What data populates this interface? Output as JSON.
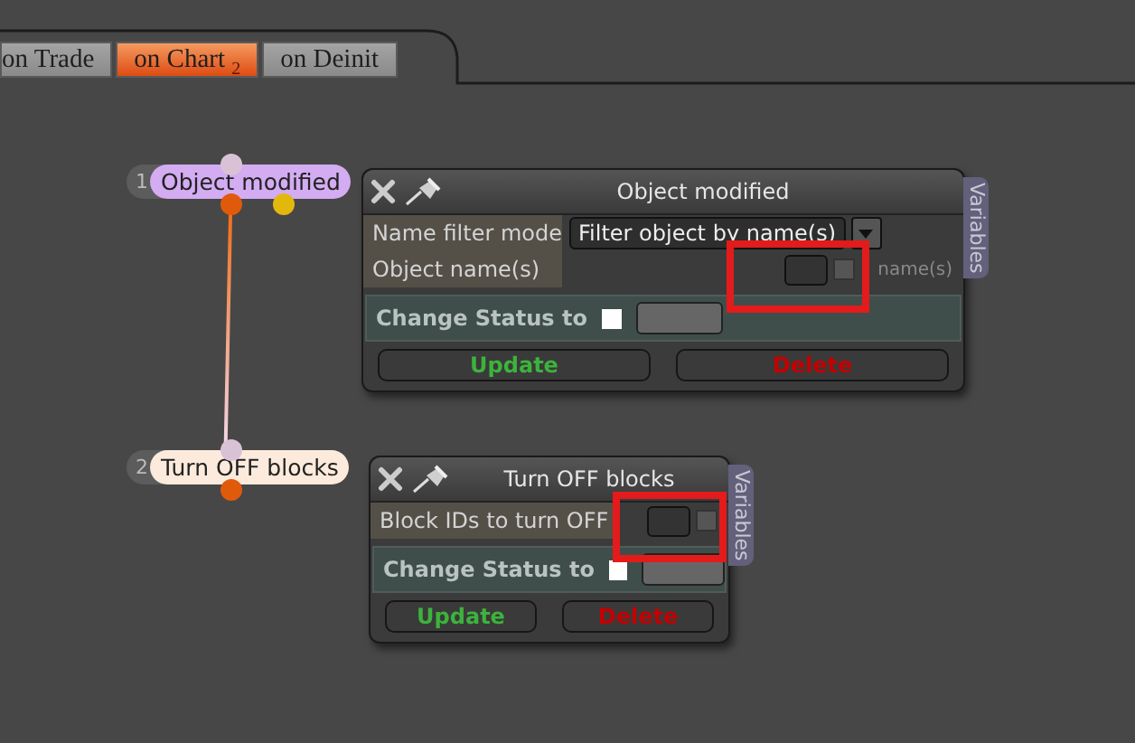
{
  "tabs": [
    {
      "label": "on Trade",
      "selected": false
    },
    {
      "label": "on Chart $_{2}$",
      "selected": true
    },
    {
      "label": "on Deinit",
      "selected": false
    }
  ],
  "nodes": [
    {
      "number": "1",
      "label": "Object modified",
      "color": "#d3acf2",
      "extra_port": true
    },
    {
      "number": "2",
      "label": "Turn OFF blocks",
      "color": "#fcebdc",
      "extra_port": false
    }
  ],
  "panels": [
    {
      "title": "Object modified",
      "side_tab": "Variables",
      "fields": [
        {
          "kind": "dropdown",
          "label": "Name filter mode",
          "value": "Filter object by name(s)",
          "highlighted": false
        },
        {
          "kind": "text",
          "label": "Object name(s)",
          "note": "name(s)",
          "highlighted": true,
          "checked": false
        }
      ],
      "status_label": "Change Status to",
      "status_checked": false,
      "buttons": [
        {
          "kind": "update",
          "label": "Update"
        },
        {
          "kind": "delete",
          "label": "Delete"
        }
      ]
    },
    {
      "title": "Turn OFF blocks",
      "side_tab": "Variables",
      "fields": [
        {
          "kind": "text",
          "label": "Block IDs to turn OFF",
          "highlighted": true,
          "checked": false
        }
      ],
      "status_label": "Change Status to",
      "status_checked": false,
      "buttons": [
        {
          "kind": "update",
          "label": "Update"
        },
        {
          "kind": "delete",
          "label": "Delete"
        }
      ]
    }
  ]
}
